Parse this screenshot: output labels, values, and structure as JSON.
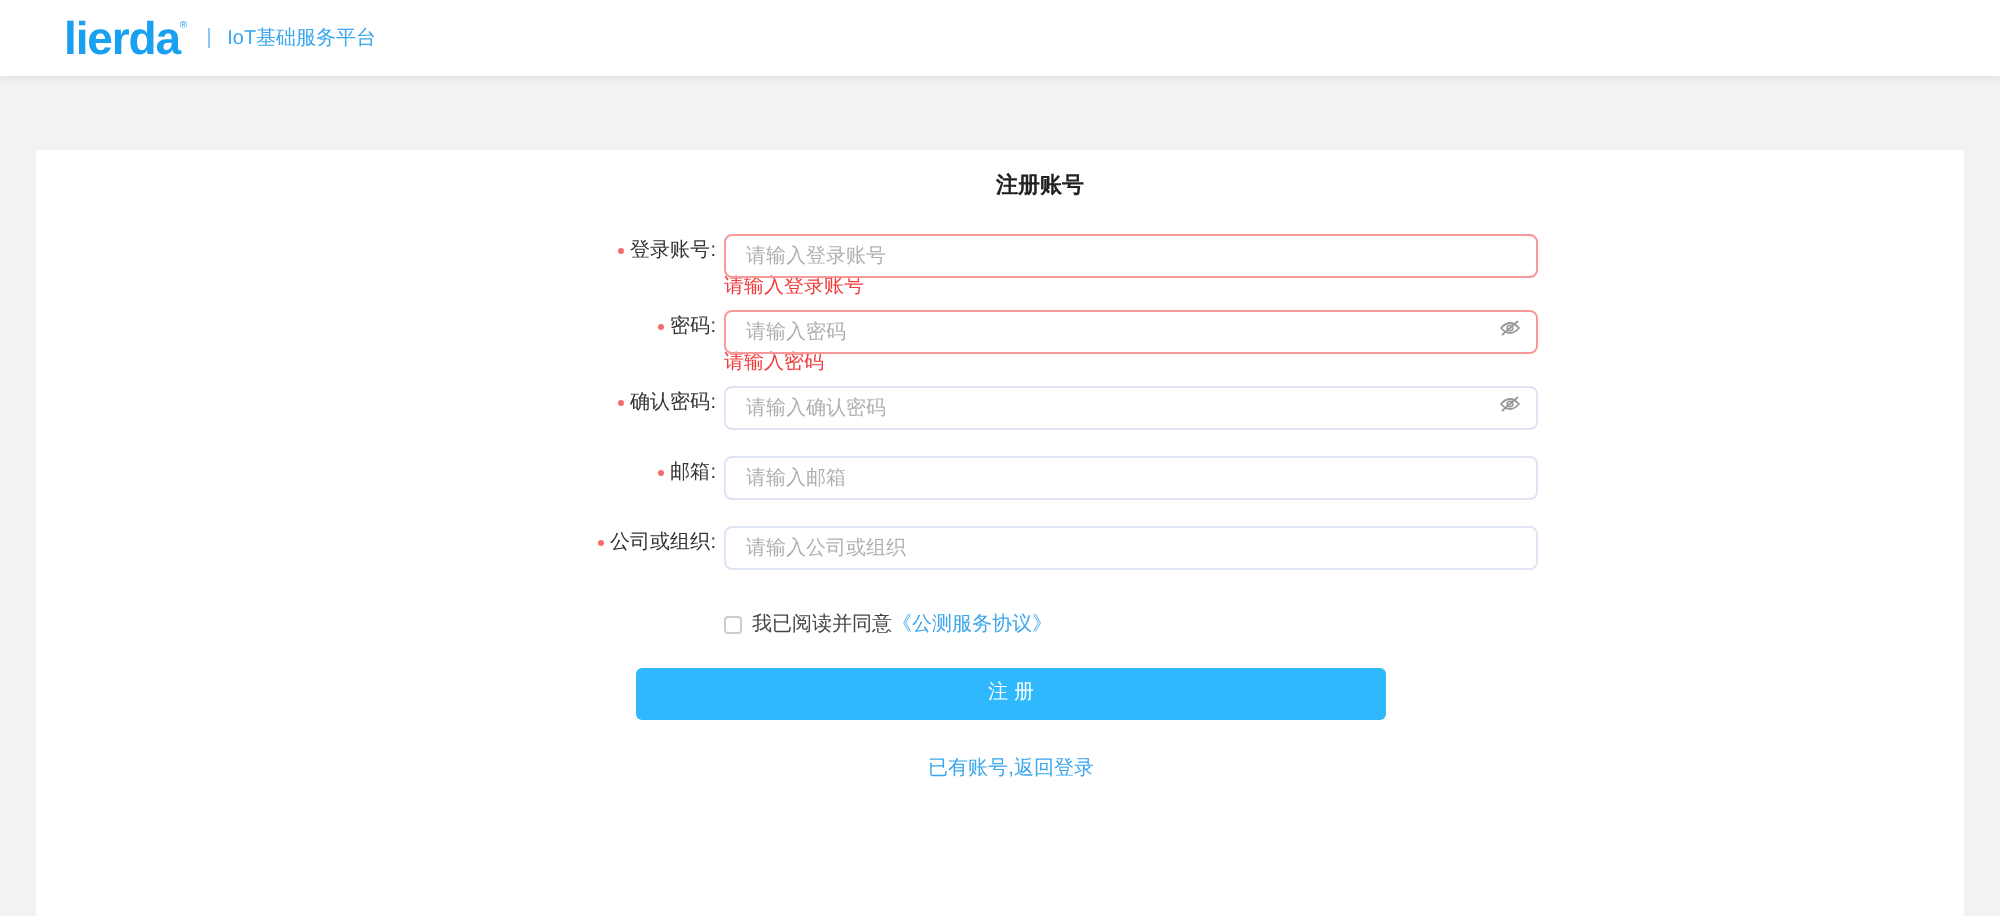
{
  "header": {
    "logo": "lierda",
    "logo_mark": "®",
    "subtitle": "IoT基础服务平台"
  },
  "form": {
    "title": "注册账号",
    "fields": [
      {
        "label": "登录账号:",
        "required": true,
        "placeholder": "请输入登录账号",
        "kind": "text",
        "error": "请输入登录账号"
      },
      {
        "label": "密码:",
        "required": true,
        "placeholder": "请输入密码",
        "kind": "password",
        "error": "请输入密码"
      },
      {
        "label": "确认密码:",
        "required": true,
        "placeholder": "请输入确认密码",
        "kind": "password"
      },
      {
        "label": "邮箱:",
        "required": true,
        "placeholder": "请输入邮箱",
        "kind": "text"
      },
      {
        "label": "公司或组织:",
        "required": true,
        "placeholder": "请输入公司或组织",
        "kind": "text"
      }
    ],
    "agreement": {
      "checked": false,
      "text": "我已阅读并同意",
      "link": "《公测服务协议》"
    },
    "submit": "注 册",
    "login_link": "已有账号,返回登录"
  }
}
